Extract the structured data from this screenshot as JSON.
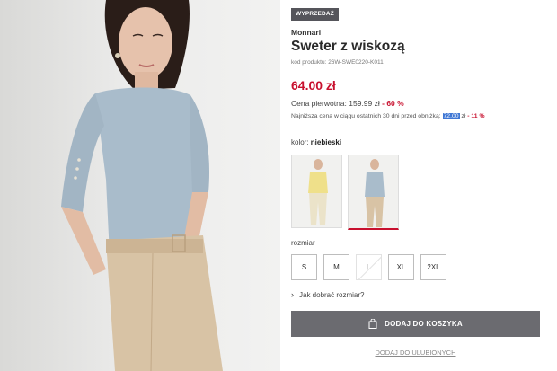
{
  "product": {
    "badge": "WYPRZEDAŻ",
    "brand": "Monnari",
    "title": "Sweter z wiskozą",
    "code": "kod produktu: 26W-SWE0220-K011",
    "price": "64.00 zł",
    "original_price_label": "Cena pierwotna: 159.99 zł",
    "original_price_discount": " - 60 %",
    "lowest_price_prefix": "Najniższa cena w ciągu ostatnich 30 dni przed obniżką: ",
    "lowest_price_value": "72.00",
    "lowest_price_suffix": " zł",
    "lowest_price_discount": " - 11 %"
  },
  "color": {
    "label": "kolor: ",
    "value": "niebieski"
  },
  "size": {
    "label": "rozmiar",
    "options": [
      "S",
      "M",
      "L",
      "XL",
      "2XL"
    ],
    "unavailable": [
      "L"
    ]
  },
  "fit_link": "Jak dobrać rozmiar?",
  "buttons": {
    "add_to_cart": "DODAJ DO KOSZYKA",
    "add_to_favorites": "DODAJ DO ULUBIONYCH"
  },
  "colors": {
    "sale_red": "#c8102e",
    "badge_bg": "#55555b",
    "cart_bg": "#6b6b70",
    "highlight": "#3f77d4",
    "sweater_blue": "#a9bccb",
    "trousers_beige": "#d8c3a5"
  }
}
